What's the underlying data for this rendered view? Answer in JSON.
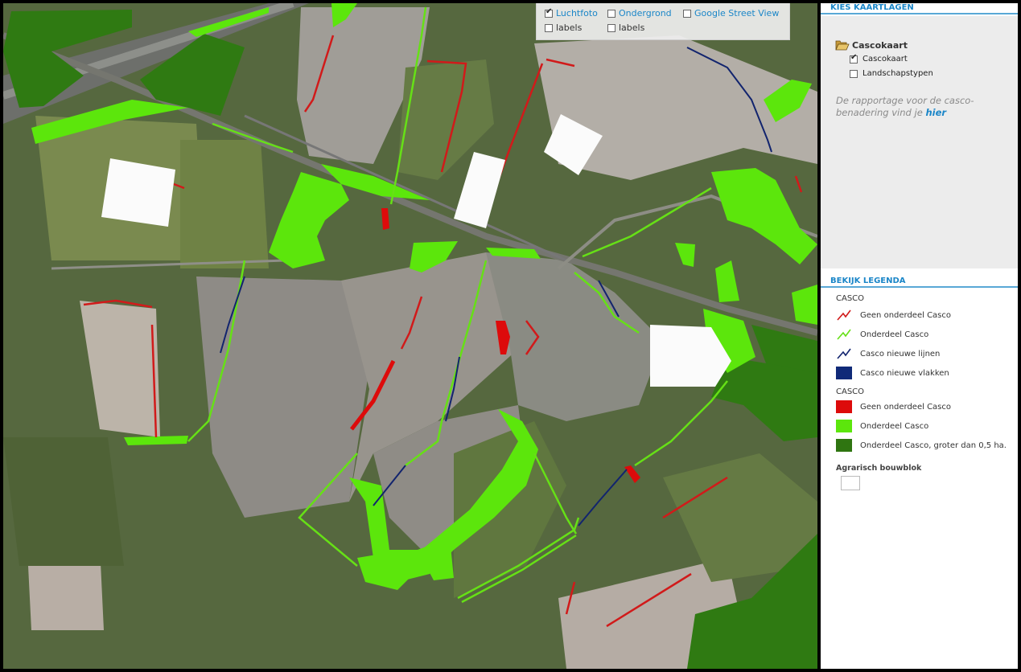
{
  "map_layers": {
    "luchtfoto": {
      "label": "Luchtfoto",
      "checked": true
    },
    "labels_1": {
      "label": "labels",
      "checked": false
    },
    "ondergrond": {
      "label": "Ondergrond",
      "checked": false
    },
    "labels_2": {
      "label": "labels",
      "checked": false
    },
    "streetview": {
      "label": "Google Street View",
      "checked": false
    }
  },
  "sidebar": {
    "layers_header": "KIES KAARTLAGEN",
    "group_title": "Cascokaart",
    "options": [
      {
        "label": "Cascokaart",
        "checked": true
      },
      {
        "label": "Landschapstypen",
        "checked": false
      }
    ],
    "report_text": "De rapportage voor de casco-benadering vind je",
    "report_link": "hier",
    "legend_header": "BEKIJK LEGENDA",
    "legend_lines_title": "CASCO",
    "legend_lines": [
      {
        "label": "Geen onderdeel Casco",
        "color": "#d11a1a"
      },
      {
        "label": "Onderdeel Casco",
        "color": "#66e016"
      },
      {
        "label": "Casco nieuwe lijnen",
        "color": "#12246e"
      }
    ],
    "legend_nieuwe_vlakken": {
      "label": "Casco nieuwe vlakken",
      "color": "#102a78"
    },
    "legend_areas_title": "CASCO",
    "legend_areas": [
      {
        "label": "Geen onderdeel Casco",
        "color": "#dd0b0b"
      },
      {
        "label": "Onderdeel Casco",
        "color": "#5ce60c"
      },
      {
        "label": "Onderdeel Casco, groter dan 0,5 ha.",
        "color": "#2f7511"
      }
    ],
    "legend_bouwblok": "Agrarisch bouwblok"
  }
}
